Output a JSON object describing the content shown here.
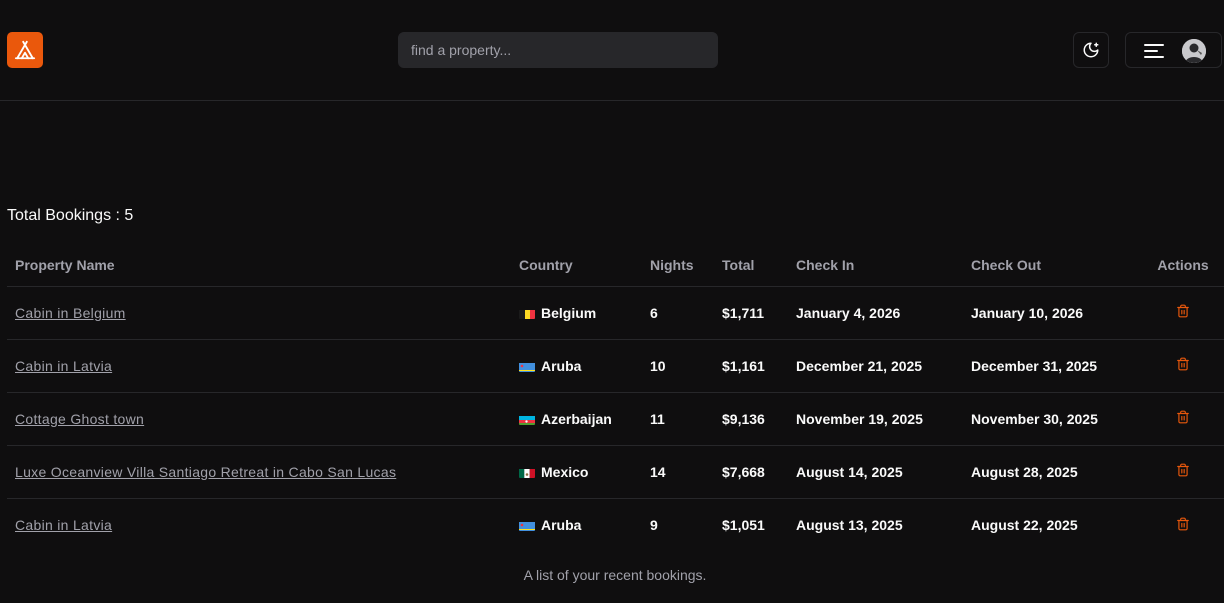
{
  "navbar": {
    "logo_icon": "tent-icon",
    "search": {
      "placeholder": "find a property..."
    },
    "theme_toggle_icon": "moon-star-icon",
    "menu_icon": "menu-lines-icon",
    "brand_color": "#ea580c"
  },
  "bookings": {
    "total_label": "Total Bookings : 5",
    "columns": [
      "Property Name",
      "Country",
      "Nights",
      "Total",
      "Check In",
      "Check Out",
      "Actions"
    ],
    "rows": [
      {
        "property": "Cabin in Belgium",
        "flag": "belgium-flag-icon",
        "country": "Belgium",
        "nights": "6",
        "total": "$1,711",
        "check_in": "January 4, 2026",
        "check_out": "January 10, 2026"
      },
      {
        "property": "Cabin in Latvia",
        "flag": "aruba-flag-icon",
        "country": "Aruba",
        "nights": "10",
        "total": "$1,161",
        "check_in": "December 21, 2025",
        "check_out": "December 31, 2025"
      },
      {
        "property": "Cottage Ghost town",
        "flag": "azerbaijan-flag-icon",
        "country": "Azerbaijan",
        "nights": "11",
        "total": "$9,136",
        "check_in": "November 19, 2025",
        "check_out": "November 30, 2025"
      },
      {
        "property": "Luxe Oceanview Villa Santiago Retreat in Cabo San Lucas",
        "flag": "mexico-flag-icon",
        "country": "Mexico",
        "nights": "14",
        "total": "$7,668",
        "check_in": "August 14, 2025",
        "check_out": "August 28, 2025"
      },
      {
        "property": "Cabin in Latvia",
        "flag": "aruba-flag-icon",
        "country": "Aruba",
        "nights": "9",
        "total": "$1,051",
        "check_in": "August 13, 2025",
        "check_out": "August 22, 2025"
      }
    ],
    "action_icon": "trash-icon",
    "caption": "A list of your recent bookings."
  }
}
